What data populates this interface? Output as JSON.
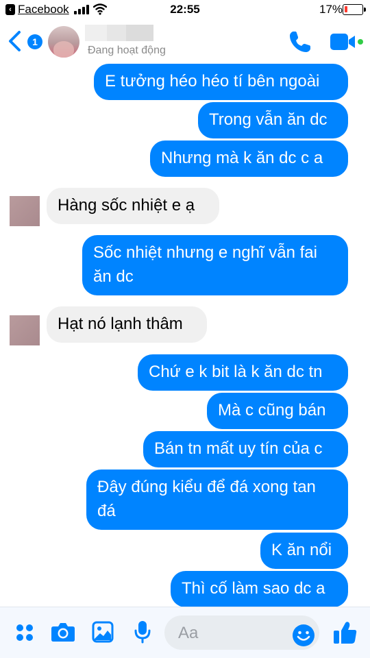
{
  "status_bar": {
    "back_app": "Facebook",
    "time": "22:55",
    "battery_percent": "17%",
    "battery_level": 0.17
  },
  "header": {
    "unread_badge": "1",
    "contact_status": "Đang hoạt động"
  },
  "messages": [
    {
      "side": "sent",
      "text": "E tưởng héo héo tí bên ngoài"
    },
    {
      "side": "sent",
      "text": "Trong vẫn ăn dc"
    },
    {
      "side": "sent",
      "text": "Nhưng mà k ăn dc c a"
    },
    {
      "side": "recv",
      "text": "Hàng sốc nhiệt e ạ"
    },
    {
      "side": "sent",
      "text": "Sốc nhiệt nhưng e nghĩ vẫn fai ăn dc"
    },
    {
      "side": "recv",
      "text": "Hạt nó lạnh thâm"
    },
    {
      "side": "sent",
      "text": "Chứ e k bit là k ăn dc tn"
    },
    {
      "side": "sent",
      "text": "Mà c cũng bán"
    },
    {
      "side": "sent",
      "text": "Bán tn mất uy tín của c"
    },
    {
      "side": "sent",
      "text": "Đây đúng kiểu để đá xong tan đá"
    },
    {
      "side": "sent",
      "text": "K ăn nổi"
    },
    {
      "side": "sent",
      "text": "Thì cố làm sao dc a"
    }
  ],
  "composer": {
    "placeholder": "Aa",
    "icons": [
      "apps-icon",
      "camera-icon",
      "image-icon",
      "microphone-icon",
      "emoji-icon",
      "thumbs-up-icon"
    ]
  },
  "colors": {
    "accent": "#0084ff",
    "received_bubble": "#f0f0f0",
    "battery_low": "#ff3b30",
    "online": "#31cc46"
  }
}
